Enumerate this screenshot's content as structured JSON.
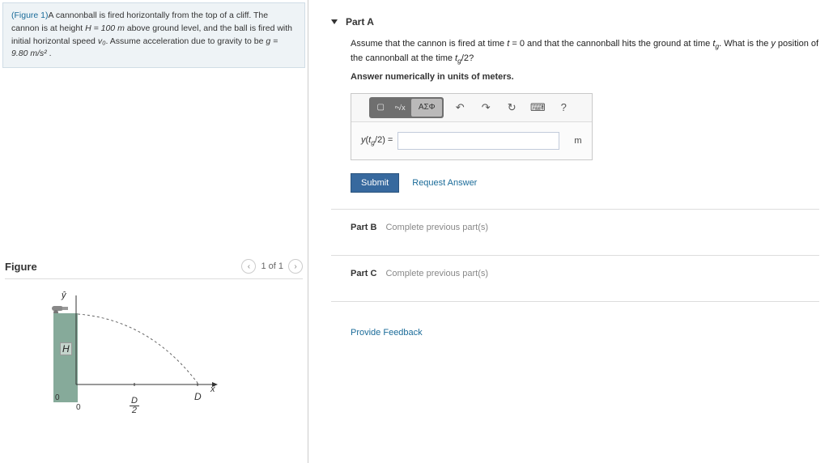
{
  "problem": {
    "figure_link": "(Figure 1)",
    "text_1": "A cannonball is fired horizontally from the top of a cliff. The cannon is at height ",
    "H_expr": "H = 100 m",
    "text_2": " above ground level, and the ball is fired with initial horizontal speed ",
    "v0": "v₀",
    "text_3": ". Assume acceleration due to gravity to be ",
    "g_expr": "g = 9.80 m/s²",
    "text_4": " ."
  },
  "figure": {
    "title": "Figure",
    "counter": "1 of 1",
    "labels": {
      "y_hat": "ŷ",
      "H": "H",
      "zero_y": "0",
      "zero_x": "0",
      "D_over_2_num": "D",
      "D_over_2_den": "2",
      "D": "D",
      "x_hat": "x̂"
    }
  },
  "partA": {
    "title": "Part A",
    "prompt_1": "Assume that the cannon is fired at time ",
    "t0": "t = 0",
    "prompt_2": " and that the cannonball hits the ground at time ",
    "tg": "t_g",
    "prompt_3": ". What is the ",
    "y": "y",
    "prompt_4": " position of the cannonball at the time ",
    "tg2": "t_g/2",
    "prompt_5": "?",
    "instruction": "Answer numerically in units of meters.",
    "lhs": "y(t_g/2) =",
    "units": "m",
    "submit": "Submit",
    "request": "Request Answer"
  },
  "toolbar": {
    "templates": "x^a",
    "sqrt": "√",
    "greek": "ΑΣΦ",
    "undo": "↶",
    "redo": "↷",
    "reset": "↻",
    "keyboard": "⌨",
    "help": "?"
  },
  "partB": {
    "title": "Part B",
    "msg": "Complete previous part(s)"
  },
  "partC": {
    "title": "Part C",
    "msg": "Complete previous part(s)"
  },
  "feedback": "Provide Feedback"
}
